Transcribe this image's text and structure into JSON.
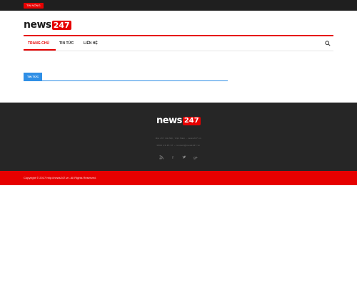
{
  "topbar": {
    "badge": "TIN NÓNG"
  },
  "logo": {
    "word": "news",
    "number": "247"
  },
  "nav": {
    "items": [
      "TRANG CHỦ",
      "TIN TỨC",
      "LIÊN HỆ"
    ],
    "search_icon": "search-icon"
  },
  "section": {
    "label": "TIN TỨC"
  },
  "footer": {
    "logo_word": "news",
    "logo_number": "247",
    "address": "Địa chỉ: Hà Nội, Việt Nam - news247.vn",
    "contact": "0901 23 45 67 - contact@news247.vn",
    "social_icons": [
      "rss-icon",
      "facebook-icon",
      "twitter-icon",
      "google-plus-icon"
    ]
  },
  "copyright": "Copyright © 2017 http://news247.vn. All Rights Reserved."
}
